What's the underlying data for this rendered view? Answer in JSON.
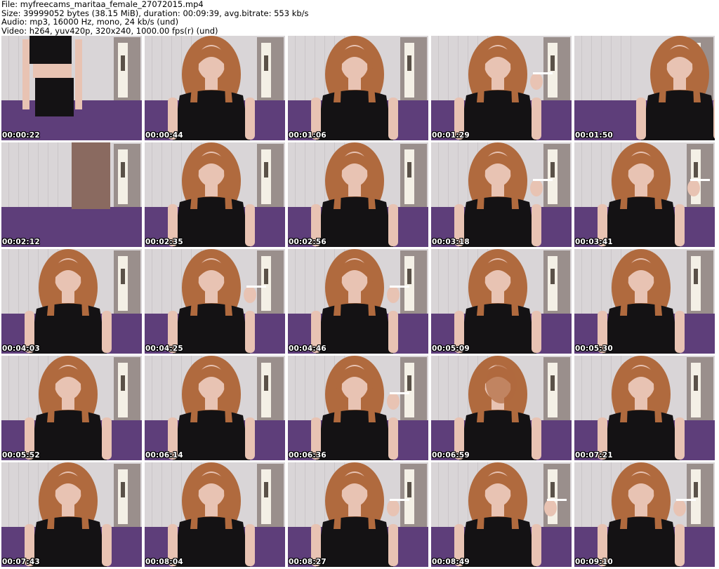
{
  "header": {
    "file": "File: myfreecams_maritaa_female_27072015.mp4",
    "size": "Size: 39999052 bytes (38.15 MiB), duration: 00:09:39, avg.bitrate: 553 kb/s",
    "audio": "Audio: mp3, 16000 Hz, mono, 24 kb/s (und)",
    "video": "Video: h264, yuv420p, 320x240, 1000.00 fps(r) (und)"
  },
  "thumbnails": [
    {
      "time": "00:00:22"
    },
    {
      "time": "00:00:44"
    },
    {
      "time": "00:01:06"
    },
    {
      "time": "00:01:29"
    },
    {
      "time": "00:01:50"
    },
    {
      "time": "00:02:12"
    },
    {
      "time": "00:02:35"
    },
    {
      "time": "00:02:56"
    },
    {
      "time": "00:03:18"
    },
    {
      "time": "00:03:41"
    },
    {
      "time": "00:04:03"
    },
    {
      "time": "00:04:25"
    },
    {
      "time": "00:04:46"
    },
    {
      "time": "00:05:09"
    },
    {
      "time": "00:05:30"
    },
    {
      "time": "00:05:52"
    },
    {
      "time": "00:06:14"
    },
    {
      "time": "00:06:36"
    },
    {
      "time": "00:06:59"
    },
    {
      "time": "00:07:21"
    },
    {
      "time": "00:07:43"
    },
    {
      "time": "00:08:04"
    },
    {
      "time": "00:08:27"
    },
    {
      "time": "00:08:49"
    },
    {
      "time": "00:09:10"
    }
  ],
  "colors": {
    "wall": "#d9d5d7",
    "door": "#9a8f8c",
    "bed": "#5e3e7a",
    "shirt": "#141214",
    "hair": "#b06a3e",
    "skin": "#e8c3b3"
  }
}
